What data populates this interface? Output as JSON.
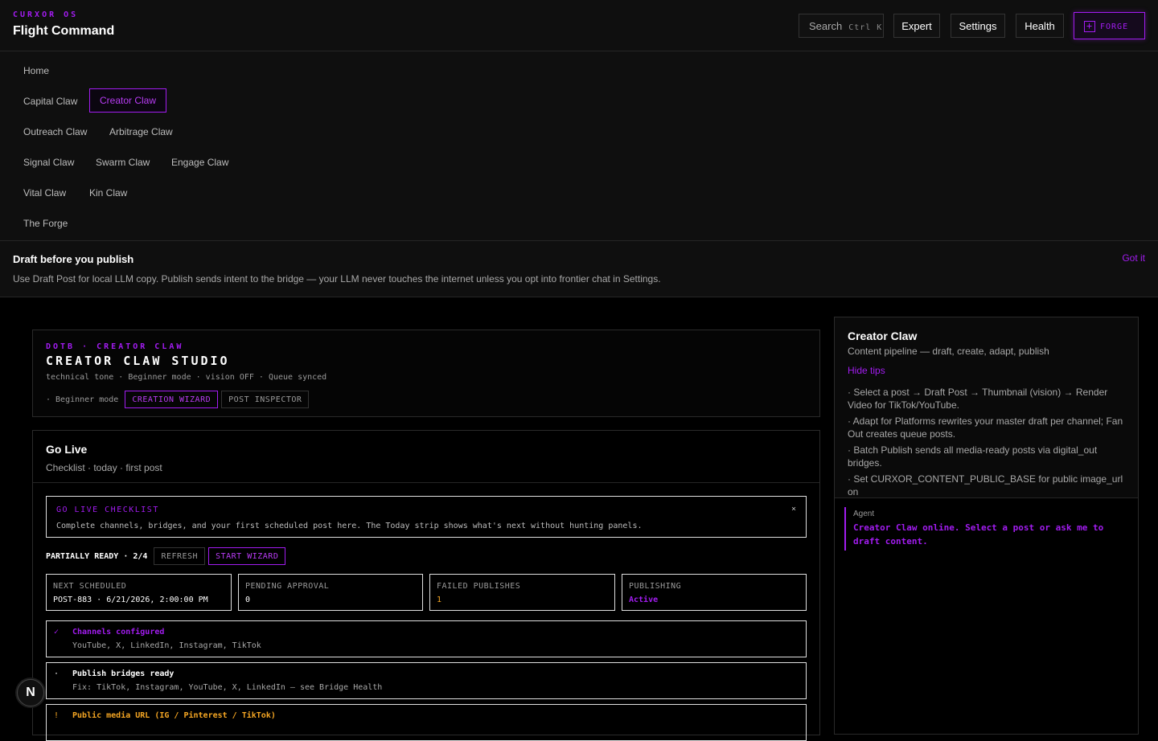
{
  "header": {
    "kicker": "CURXOR OS",
    "title": "Flight Command",
    "search_label": "Search",
    "search_shortcut": "Ctrl K",
    "buttons": [
      "Expert",
      "Settings",
      "Health"
    ],
    "forge_label": "FORGE"
  },
  "nav": {
    "items": [
      "Home",
      "Capital Claw",
      "Creator Claw",
      "Outreach Claw",
      "Arbitrage Claw",
      "Signal Claw",
      "Swarm Claw",
      "Engage Claw",
      "Vital Claw",
      "Kin Claw",
      "The Forge"
    ],
    "active": "Creator Claw"
  },
  "tip": {
    "title": "Draft before you publish",
    "text": "Use Draft Post for local LLM copy. Publish sends intent to the bridge — your LLM never touches the internet unless you opt into frontier chat in Settings.",
    "dismiss": "Got it"
  },
  "studio": {
    "kicker": "DOTB · CREATOR CLAW",
    "title": "CREATOR CLAW STUDIO",
    "meta": "technical tone · Beginner mode · vision OFF · Queue synced",
    "mode_label": "· Beginner mode",
    "wizard_btn": "CREATION WIZARD",
    "inspector_btn": "POST INSPECTOR"
  },
  "golive": {
    "title": "Go Live",
    "subtitle": "Checklist · today · first post",
    "checklist_title": "GO LIVE CHECKLIST",
    "checklist_text": "Complete channels, bridges, and your first scheduled post here. The Today strip shows what's next without hunting panels.",
    "close": "×",
    "status": "PARTIALLY READY · 2/4",
    "refresh": "REFRESH",
    "start": "START WIZARD",
    "stats": [
      {
        "label": "NEXT SCHEDULED",
        "value": "POST-883 · 6/21/2026, 2:00:00 PM",
        "color": "#ffffff"
      },
      {
        "label": "PENDING APPROVAL",
        "value": "0",
        "color": "#ffffff"
      },
      {
        "label": "FAILED PUBLISHES",
        "value": "1",
        "color": "#f5a623"
      },
      {
        "label": "PUBLISHING",
        "value": "Active",
        "color": "#a21cf0"
      }
    ],
    "items": [
      {
        "mark": "✓",
        "title": "Channels configured",
        "desc": "YouTube, X, LinkedIn, Instagram, TikTok",
        "color": "#a21cf0"
      },
      {
        "mark": "·",
        "title": "Publish bridges ready",
        "desc": "Fix: TikTok, Instagram, YouTube, X, LinkedIn — see Bridge Health",
        "color": "#ffffff"
      },
      {
        "mark": "!",
        "title": "Public media URL (IG / Pinterest / TikTok)",
        "desc": "",
        "color": "#f5a623"
      }
    ]
  },
  "side": {
    "title": "Creator Claw",
    "subtitle": "Content pipeline — draft, create, adapt, publish",
    "hide": "Hide tips",
    "tips": [
      "· Select a post → Draft Post → Thumbnail (vision) → Render Video for TikTok/YouTube.",
      "· Adapt for Platforms rewrites your master draft per channel; Fan Out creates queue posts.",
      "· Batch Publish sends all media-ready posts via digital_out bridges.",
      "· Set CURXOR_CONTENT_PUBLIC_BASE for public image_url on"
    ],
    "agent_label": "Agent",
    "agent_msg": "Creator Claw online. Select a post or ask me to draft content."
  },
  "badge": "N",
  "colors": {
    "accent": "#a21cf0",
    "warning": "#f5a623",
    "background": "#000000"
  }
}
